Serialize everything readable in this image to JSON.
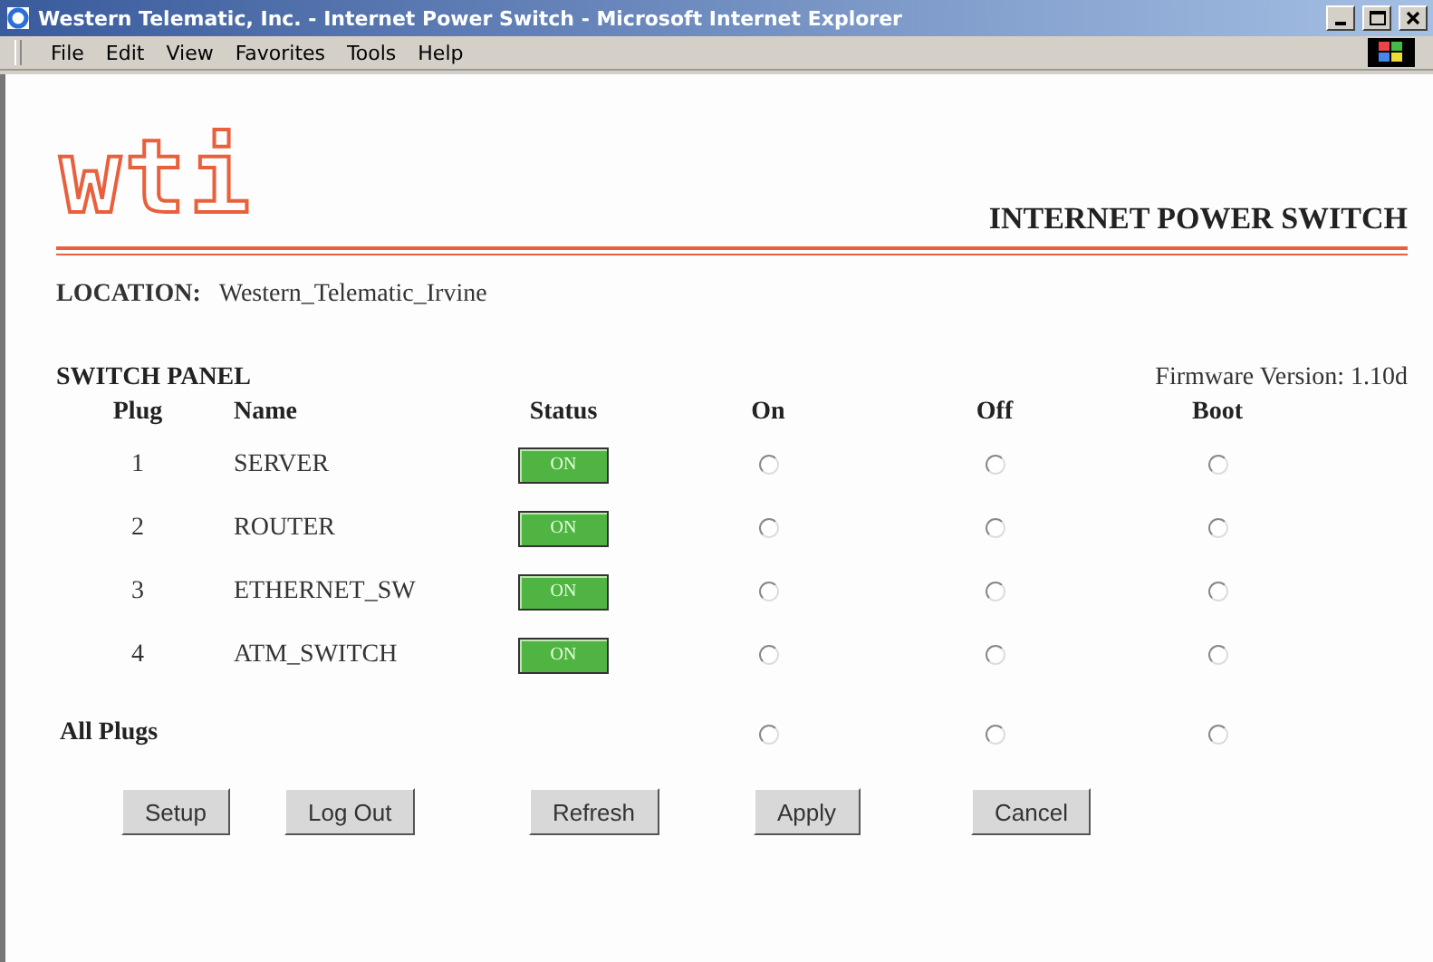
{
  "window": {
    "title": "Western Telematic, Inc. - Internet Power Switch - Microsoft Internet Explorer"
  },
  "menu": [
    "File",
    "Edit",
    "View",
    "Favorites",
    "Tools",
    "Help"
  ],
  "header": {
    "logo": "wti",
    "title": "INTERNET POWER SWITCH"
  },
  "location": {
    "label": "LOCATION:",
    "value": "Western_Telematic_Irvine"
  },
  "panel": {
    "title": "SWITCH PANEL",
    "firmware": "Firmware Version: 1.10d",
    "columns": [
      "Plug",
      "Name",
      "Status",
      "On",
      "Off",
      "Boot"
    ],
    "rows": [
      {
        "plug": "1",
        "name": "SERVER",
        "status": "ON",
        "on": true,
        "actions": [
          {
            "selected": false
          },
          {
            "selected": false
          },
          {
            "selected": false
          }
        ]
      },
      {
        "plug": "2",
        "name": "ROUTER",
        "status": "ON",
        "on": true,
        "actions": [
          {
            "selected": false
          },
          {
            "selected": false
          },
          {
            "selected": false
          }
        ]
      },
      {
        "plug": "3",
        "name": "ETHERNET_SW",
        "status": "ON",
        "on": true,
        "actions": [
          {
            "selected": false
          },
          {
            "selected": false
          },
          {
            "selected": false
          }
        ]
      },
      {
        "plug": "4",
        "name": "ATM_SWITCH",
        "status": "ON",
        "on": true,
        "actions": [
          {
            "selected": false
          },
          {
            "selected": false
          },
          {
            "selected": false
          }
        ]
      }
    ],
    "all": {
      "label": "All Plugs",
      "actions": [
        {
          "selected": false
        },
        {
          "selected": false
        },
        {
          "selected": false
        }
      ]
    }
  },
  "buttons": [
    "Setup",
    "Log Out",
    "Refresh",
    "Apply",
    "Cancel"
  ]
}
